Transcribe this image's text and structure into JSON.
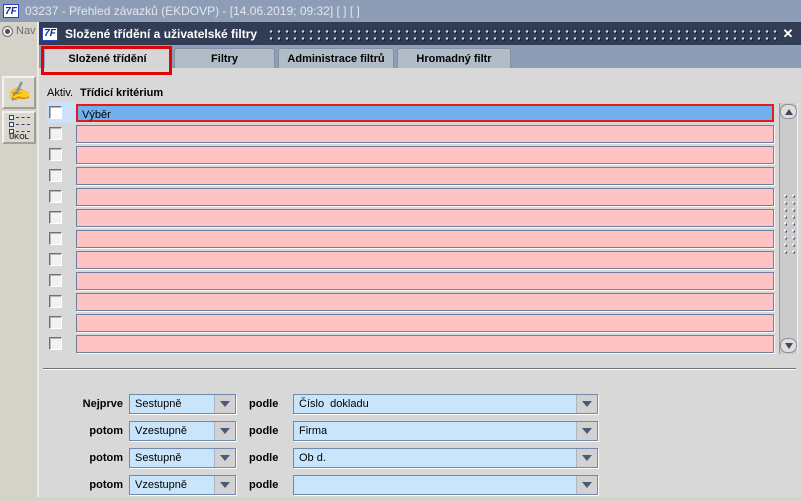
{
  "window": {
    "logo": "7F",
    "title": "03237 - Přehled závazků (EKDOVP) - [14.06.2019; 09:32]  [ ]  [ ]"
  },
  "background_toolbar": {
    "nav_label": "Nav",
    "task_label": "ÚKOL"
  },
  "dialog": {
    "logo": "7F",
    "title": "Složené třídění a uživatelské filtry",
    "close_glyph": "✕",
    "tabs": [
      {
        "label": "Složené třídění"
      },
      {
        "label": "Filtry"
      },
      {
        "label": "Administrace filtrů"
      },
      {
        "label": "Hromadný filtr"
      }
    ],
    "criteria": {
      "checkbox_header": "Aktiv.",
      "column_header": "Třídicí kritérium",
      "rows": [
        {
          "value": "Výběr"
        },
        {
          "value": ""
        },
        {
          "value": ""
        },
        {
          "value": ""
        },
        {
          "value": ""
        },
        {
          "value": ""
        },
        {
          "value": ""
        },
        {
          "value": ""
        },
        {
          "value": ""
        },
        {
          "value": ""
        },
        {
          "value": ""
        },
        {
          "value": ""
        }
      ]
    },
    "sort": {
      "rows": [
        {
          "label": "Nejprve",
          "order": "Sestupně",
          "podle": "podle",
          "field": "Číslo  dokladu"
        },
        {
          "label": "potom",
          "order": "Vzestupně",
          "podle": "podle",
          "field": "Firma"
        },
        {
          "label": "potom",
          "order": "Sestupně",
          "podle": "podle",
          "field": "Ob d."
        },
        {
          "label": "potom",
          "order": "Vzestupně",
          "podle": "podle",
          "field": ""
        }
      ]
    }
  },
  "colors": {
    "top_titlebar": "#8c9db5",
    "dialog_titlebar": "#313d54",
    "content_background": "#d8d8d8",
    "field_pink": "#ffc3c3",
    "selected_row_blue": "#6fb1ef",
    "dropdown_blue": "#c9e5fc",
    "annotation_red": "#dd0505"
  }
}
